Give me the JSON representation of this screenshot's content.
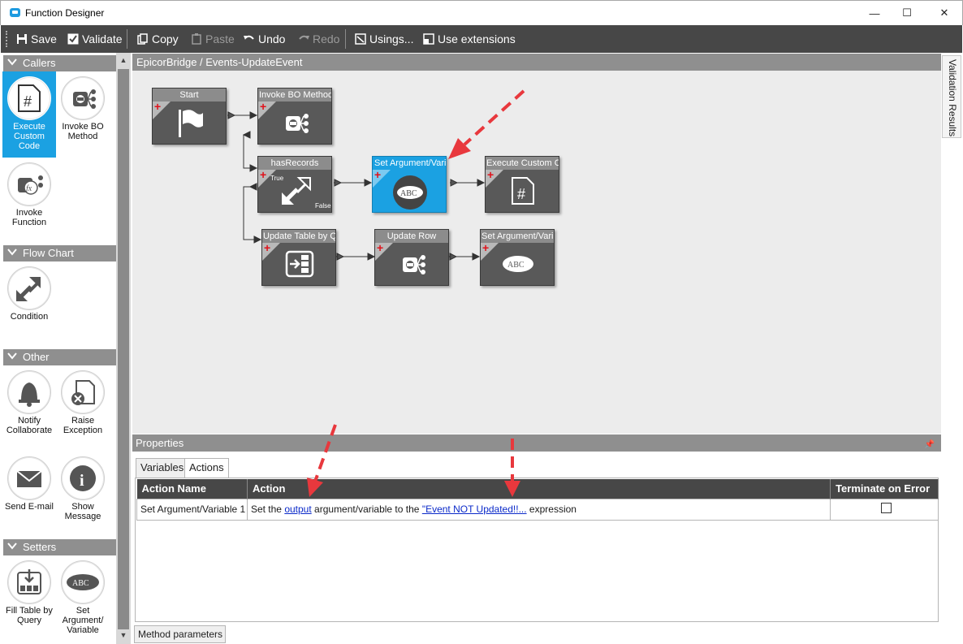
{
  "window": {
    "title": "Function Designer",
    "minimize": "—",
    "maximize": "☐",
    "close": "✕"
  },
  "toolbar": {
    "save": "Save",
    "validate": "Validate",
    "copy": "Copy",
    "paste": "Paste",
    "undo": "Undo",
    "redo": "Redo",
    "usings": "Usings...",
    "use_extensions": "Use extensions"
  },
  "palette": {
    "callers": {
      "header": "Callers",
      "items": [
        "Execute Custom Code",
        "Invoke BO Method",
        "Invoke Function"
      ]
    },
    "flowchart": {
      "header": "Flow Chart",
      "items": [
        "Condition"
      ]
    },
    "other": {
      "header": "Other",
      "items": [
        "Notify Collaborate",
        "Raise Exception",
        "Send E-mail",
        "Show Message"
      ]
    },
    "setters": {
      "header": "Setters",
      "items": [
        "Fill Table by Query",
        "Set Argument/ Variable"
      ]
    }
  },
  "canvas": {
    "breadcrumb": "EpicorBridge / Events-UpdateEvent",
    "side_tab": "Validation Results",
    "nodes": {
      "start": "Start",
      "invoke_bo": "Invoke BO Method",
      "has_records": "hasRecords",
      "has_records_true": "True",
      "has_records_false": "False",
      "set_arg_1": "Set Argument/Vari",
      "exec_custom": "Execute Custom Co",
      "update_table": "Update Table by Q",
      "update_row": "Update Row",
      "set_arg_2": "Set Argument/Vari",
      "abc": "ABC"
    }
  },
  "properties": {
    "header": "Properties",
    "tabs": [
      "Variables",
      "Actions"
    ],
    "columns": [
      "Action Name",
      "Action",
      "Terminate on Error"
    ],
    "row": {
      "name": "Set Argument/Variable 1",
      "action_prefix": "Set the",
      "action_link1": "output",
      "action_mid": "argument/variable to the",
      "action_link2": "\"Event NOT Updated!!...",
      "action_suffix": "expression"
    },
    "bottom_tab": "Method parameters"
  },
  "colors": {
    "accent": "#1ba1e2",
    "node": "#595959",
    "arrow": "#e8383d"
  }
}
